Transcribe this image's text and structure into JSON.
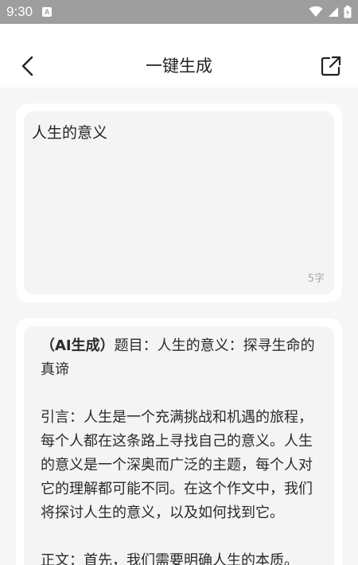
{
  "status_bar": {
    "time": "9:30",
    "notification_icon": "a-icon",
    "icons": [
      "wifi-icon",
      "signal-icon",
      "battery-icon"
    ]
  },
  "header": {
    "title": "一键生成",
    "back_icon": "chevron-left-icon",
    "share_icon": "external-link-icon"
  },
  "input": {
    "value": "人生的意义",
    "char_count": "5字"
  },
  "result": {
    "tag": "（AI生成）",
    "text": "题目：人生的意义：探寻生命的真谛\n\n引言：人生是一个充满挑战和机遇的旅程，每个人都在这条路上寻找自己的意义。人生的意义是一个深奥而广泛的主题，每个人对它的理解都可能不同。在这个作文中，我们将探讨人生的意义，以及如何找到它。\n\n正文：首先，我们需要明确人生的本质。"
  },
  "colors": {
    "status_bar": "#9e9e9e",
    "page_bg": "#f6f6f6",
    "panel_inner": "#f3f4f3"
  }
}
